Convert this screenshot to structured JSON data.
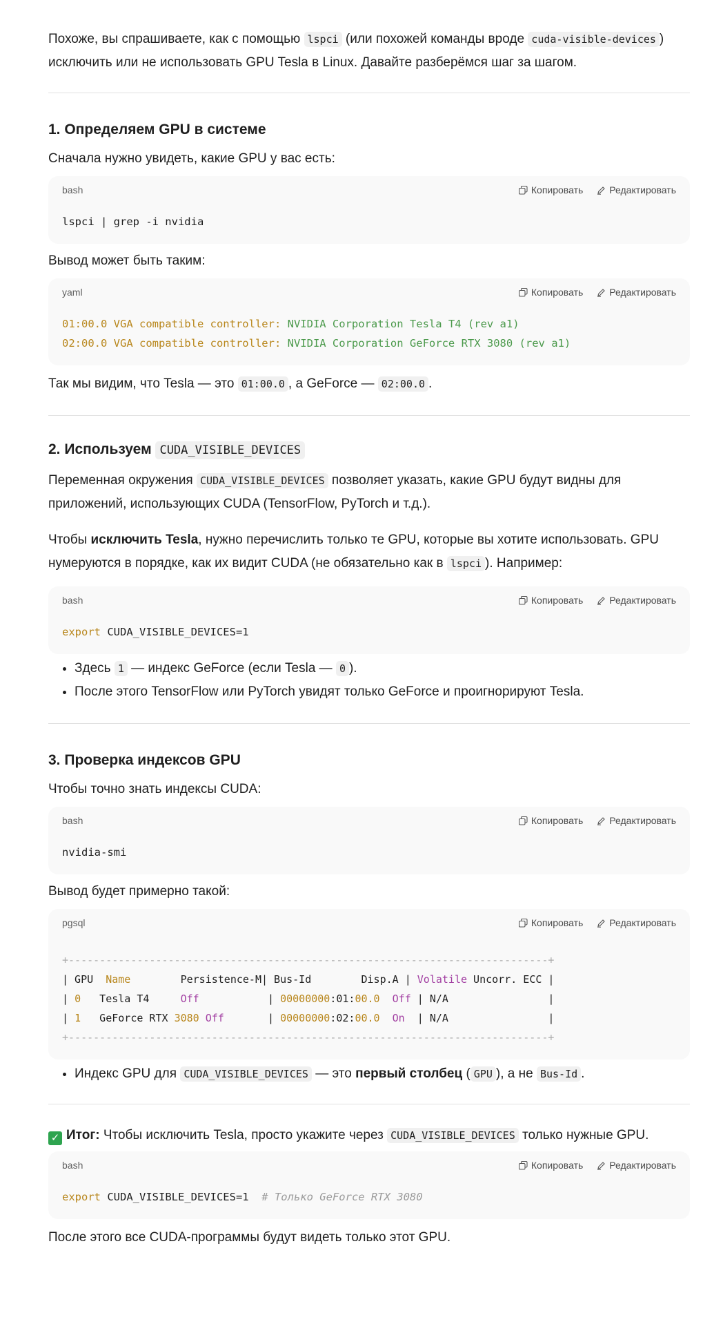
{
  "intro": {
    "t1": "Похоже, вы спрашиваете, как с помощью ",
    "c1": "lspci",
    "t2": " (или похожей команды вроде ",
    "c2": "cuda-visible-devices",
    "t3": ")",
    "t4": "исключить или не использовать GPU Tesla в Linux. Давайте разберёмся шаг за шагом."
  },
  "code_actions": {
    "copy": "Копировать",
    "edit": "Редактировать"
  },
  "section1": {
    "title": "1. Определяем GPU в системе",
    "p1": "Сначала нужно увидеть, какие GPU у вас есть:",
    "code1_lang": "bash",
    "code1_line": "lspci | grep -i nvidia",
    "p2": "Вывод может быть таким:",
    "code2_lang": "yaml",
    "code2_l1_key": "01:00.0 VGA compatible controller:",
    "code2_l1_val": " NVIDIA Corporation Tesla T4 (rev a1)",
    "code2_l2_key": "02:00.0 VGA compatible controller:",
    "code2_l2_val": " NVIDIA Corporation GeForce RTX 3080 (rev a1)",
    "p3_a": "Так мы видим, что Tesla — это ",
    "p3_c1": "01:00.0",
    "p3_b": ", а GeForce — ",
    "p3_c2": "02:00.0",
    "p3_c": "."
  },
  "section2": {
    "title": "2. Используем ",
    "title_code": "CUDA_VISIBLE_DEVICES",
    "p1_a": "Переменная окружения ",
    "p1_code": "CUDA_VISIBLE_DEVICES",
    "p1_b": " позволяет указать, какие GPU будут видны для",
    "p1_c": "приложений, использующих CUDA (TensorFlow, PyTorch и т.д.).",
    "p2_a": "Чтобы ",
    "p2_bold": "исключить Tesla",
    "p2_b": ", нужно перечислить только те GPU, которые вы хотите использовать. GPU",
    "p2_c": "нумеруются в порядке, как их видит CUDA (не обязательно как в ",
    "p2_code": "lspci",
    "p2_d": "). Например:",
    "code_lang": "bash",
    "code_kw": "export",
    "code_rest": " CUDA_VISIBLE_DEVICES=1",
    "li1_a": "Здесь ",
    "li1_c1": "1",
    "li1_b": " — индекс GeForce (если Tesla — ",
    "li1_c2": "0",
    "li1_c": ").",
    "li2": "После этого TensorFlow или PyTorch увидят только GeForce и проигнорируют Tesla."
  },
  "section3": {
    "title": "3. Проверка индексов GPU",
    "p1": "Чтобы точно знать индексы CUDA:",
    "code1_lang": "bash",
    "code1_line": "nvidia-smi",
    "p2": "Вывод будет примерно такой:",
    "code2_lang": "pgsql",
    "border": "+-----------------------------------------------------------------------------+",
    "h_gpu": "| GPU  ",
    "h_name": "Name",
    "h_mid": "        Persistence-M| Bus-Id        Disp.A | ",
    "h_vol": "Volatile",
    "h_end": " Uncorr. ECC |",
    "r1_pipe": "| ",
    "r1_idx": "0",
    "r1_name": "   Tesla T4     ",
    "r1_off": "Off",
    "r1_mid": "           | ",
    "r1_bus_num": "00000000",
    "r1_bus_rest": ":01:",
    "r1_bus_end": "00.0",
    "r1_sp": "  ",
    "r1_disp": "Off",
    "r1_end": " | N/A                |",
    "r2_pipe": "| ",
    "r2_idx": "1",
    "r2_name": "   GeForce RTX ",
    "r2_num": "3080",
    "r2_sp": " ",
    "r2_off": "Off",
    "r2_mid": "       | ",
    "r2_bus_num": "00000000",
    "r2_bus_rest": ":02:",
    "r2_bus_end": "00.0",
    "r2_sp2": "  ",
    "r2_disp": "On",
    "r2_end": "  | N/A                |",
    "li1_a": "Индекс GPU для ",
    "li1_code": "CUDA_VISIBLE_DEVICES",
    "li1_b": " — это ",
    "li1_bold": "первый столбец",
    "li1_c": " (",
    "li1_code2": "GPU",
    "li1_d": "), а не ",
    "li1_code3": "Bus-Id",
    "li1_e": "."
  },
  "summary": {
    "check": "✓",
    "bold": "Итог:",
    "t1": " Чтобы исключить Tesla, просто укажите через ",
    "code": "CUDA_VISIBLE_DEVICES",
    "t2": " только нужные GPU.",
    "code_lang": "bash",
    "code_kw": "export",
    "code_rest": " CUDA_VISIBLE_DEVICES=1  ",
    "code_cmt": "# Только GeForce RTX 3080",
    "final": "После этого все CUDA-программы будут видеть только этот GPU."
  }
}
